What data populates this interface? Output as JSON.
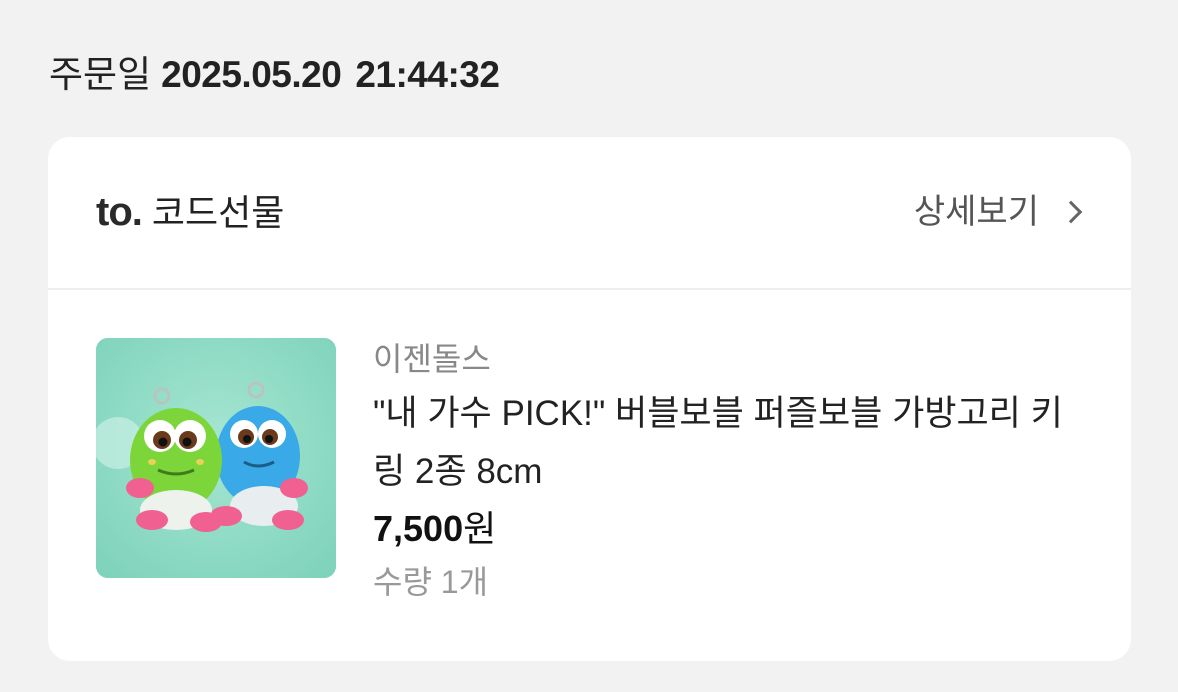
{
  "order": {
    "date_label": "주문일",
    "date": "2025.05.20",
    "time": "21:44:32"
  },
  "gift": {
    "to_label": "to.",
    "recipient": "코드선물",
    "detail_label": "상세보기"
  },
  "product": {
    "brand": "이젠돌스",
    "title": "\"내 가수 PICK!\" 버블보블 퍼즐보블 가방고리 키링 2종 8cm",
    "price": "7,500",
    "currency": "원",
    "quantity": "수량 1개",
    "image_icon": "product-thumbnail",
    "colors": {
      "background": "#8fdcc5",
      "green_doll": "#7cd63a",
      "blue_doll": "#3aa9e8"
    }
  }
}
